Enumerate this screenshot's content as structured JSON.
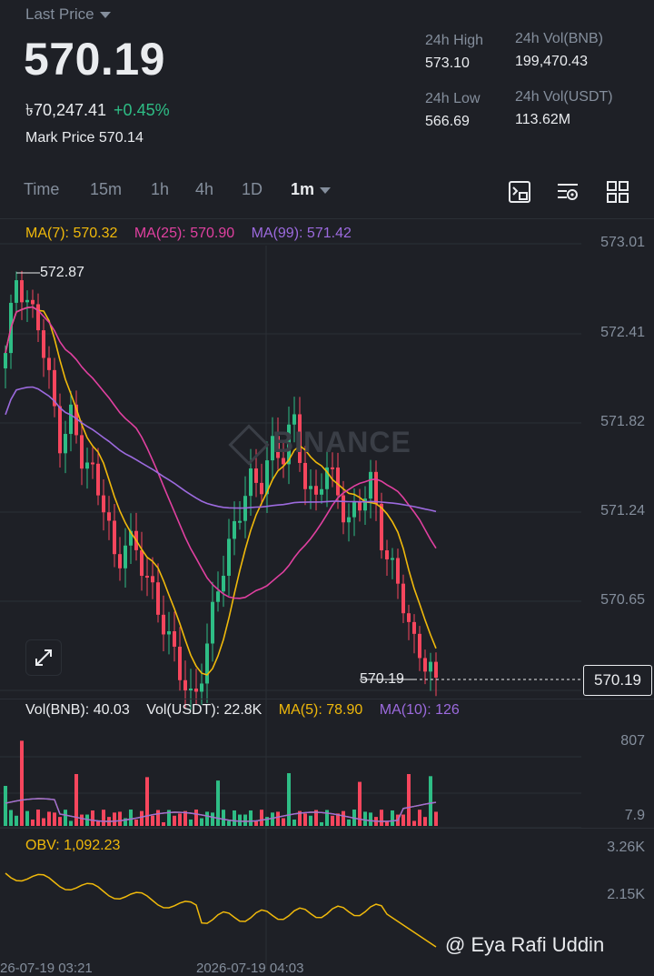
{
  "header": {
    "last_price_label": "Last Price",
    "last_price": "570.19",
    "fiat_price": "৳70,247.41",
    "change_pct": "+0.45%",
    "mark_price_label": "Mark Price",
    "mark_price": "570.14"
  },
  "stats": {
    "high_label": "24h High",
    "high": "573.10",
    "low_label": "24h Low",
    "low": "566.69",
    "vol_bnb_label": "24h Vol(BNB)",
    "vol_bnb": "199,470.43",
    "vol_usdt_label": "24h Vol(USDT)",
    "vol_usdt": "113.62M"
  },
  "timeframes": [
    "Time",
    "15m",
    "1h",
    "4h",
    "1D",
    "1m"
  ],
  "active_timeframe": "1m",
  "toolbar_icons": [
    "chart-settings-icon",
    "indicator-icon",
    "layout-grid-icon"
  ],
  "ma": {
    "ma7": "MA(7): 570.32",
    "ma25": "MA(25): 570.90",
    "ma99": "MA(99): 571.42"
  },
  "price_axis": [
    "573.01",
    "572.41",
    "571.82",
    "571.24",
    "570.65"
  ],
  "annotations": {
    "high_marker": "572.87",
    "last_marker": "570.19",
    "current_price_tag": "570.19"
  },
  "watermark": "BINANCE",
  "volume": {
    "vol_bnb": "Vol(BNB): 40.03",
    "vol_usdt": "Vol(USDT): 22.8K",
    "ma5": "MA(5): 78.90",
    "ma10": "MA(10): 126",
    "axis_top": "807",
    "axis_bottom": "7.9"
  },
  "obv": {
    "label": "OBV: 1,092.23",
    "axis_top": "3.26K",
    "axis_mid": "2.15K"
  },
  "time_axis": [
    "26-07-19 03:21",
    "2026-07-19 04:03"
  ],
  "credit": "@ Eya Rafi Uddin",
  "colors": {
    "up": "#2ebd85",
    "down": "#f6465d",
    "ma7": "#f0b90b",
    "ma25": "#e040a0",
    "ma99": "#9c6ade",
    "background": "#1e2026"
  },
  "chart_data": {
    "type": "candlestick",
    "ylim": [
      570.19,
      573.01
    ],
    "close_series": [
      572.3,
      572.8,
      572.6,
      572.5,
      572.1,
      571.7,
      571.9,
      571.6,
      571.5,
      571.3,
      570.9,
      571.1,
      571.0,
      570.8,
      570.6,
      570.4,
      570.2,
      570.0,
      570.3,
      570.7,
      571.0,
      571.2,
      571.5,
      571.4,
      571.7,
      571.6,
      571.9,
      571.5,
      571.3,
      571.6,
      571.4,
      571.2,
      571.3,
      571.5,
      571.1,
      570.9,
      570.7,
      570.4,
      570.3,
      570.19
    ]
  }
}
